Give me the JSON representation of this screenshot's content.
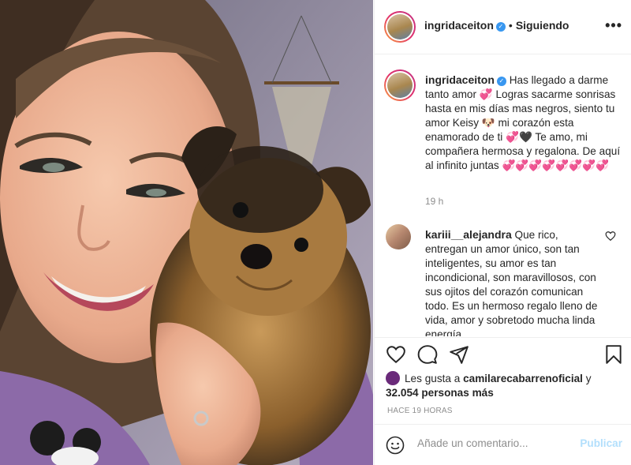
{
  "post": {
    "username": "ingridaceiton",
    "verified": true,
    "separator": "•",
    "following_label": "Siguiendo",
    "more_label": "•••"
  },
  "caption": {
    "username": "ingridaceiton",
    "text": "Has llegado a darme tanto amor 💞 Logras sacarme sonrisas hasta en mis días mas negros, siento tu amor Keisy 🐶 mi corazón esta enamorado de ti 💞🖤 Te amo, mi compañera hermosa y regalona. De aquí al infinito juntas 💞💞💞💞💞💞💞💞",
    "time": "19 h"
  },
  "comment": {
    "username": "kariii__alejandra",
    "text": "Que rico, entregan un amor único, son tan inteligentes, su amor es tan incondicional, son maravillosos, con sus ojitos del corazón comunican todo. Es un hermoso regalo lleno de vida, amor y sobretodo mucha linda energía"
  },
  "likes": {
    "prefix": "Les gusta a",
    "user": "camilarecabarrenoficial",
    "and": "y",
    "count_text": "32.054 personas más"
  },
  "timestamp": "HACE 19 HORAS",
  "add_comment": {
    "placeholder": "Añade un comentario...",
    "publish_label": "Publicar"
  },
  "colors": {
    "accent": "#3897f0",
    "publish_disabled": "#b2dffc",
    "secondary_text": "#8e8e8e",
    "border": "#efefef"
  },
  "icons": [
    "heart-icon",
    "comment-icon",
    "share-icon",
    "bookmark-icon",
    "emoji-icon",
    "more-icon",
    "verified-icon"
  ]
}
